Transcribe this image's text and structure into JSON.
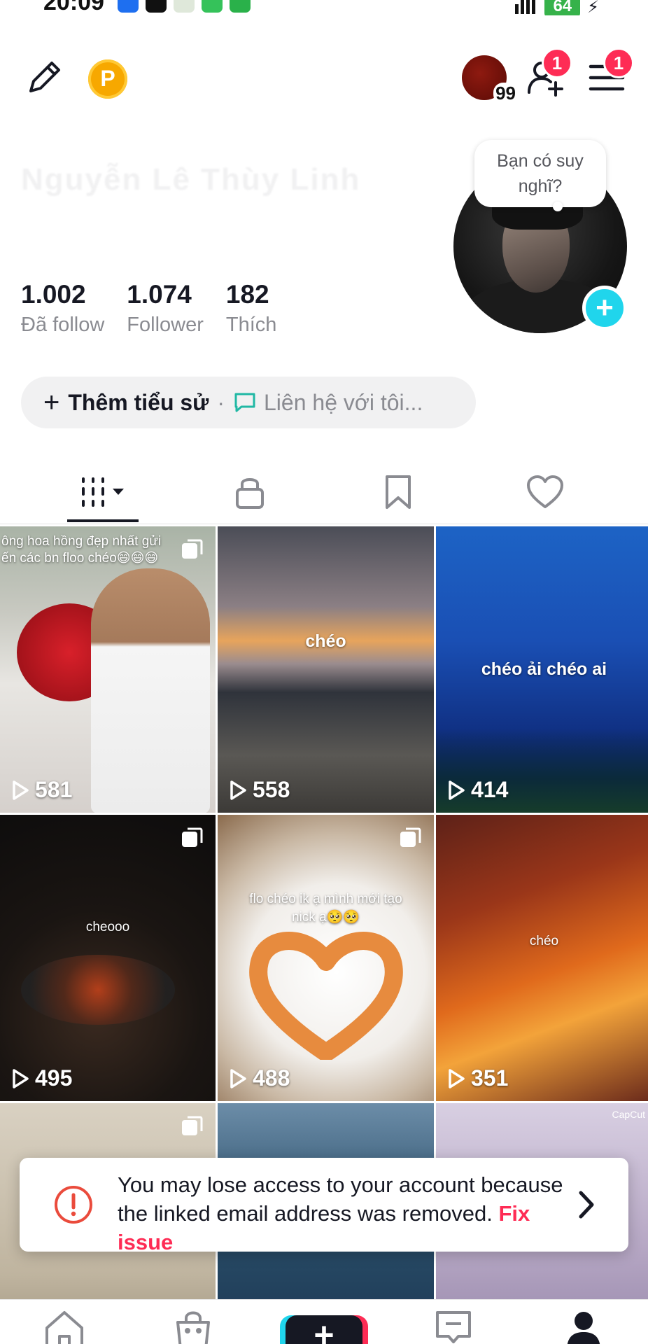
{
  "status_bar": {
    "time": "20:09",
    "battery": "64",
    "app_icons": [
      "zalo-icon",
      "tiktok-icon",
      "shield-app-icon",
      "message-app-icon",
      "grid-app-icon"
    ]
  },
  "topbar": {
    "mini_avatar_count": "99",
    "follow_requests_badge": "1",
    "menu_badge": "1",
    "coin_letter": "P"
  },
  "profile": {
    "name_blurred": "Nguyễn Lê Thùy Linh",
    "thought_bubble": "Bạn có suy nghĩ?",
    "stats": [
      {
        "value": "1.002",
        "label": "Đã follow"
      },
      {
        "value": "1.074",
        "label": "Follower"
      },
      {
        "value": "182",
        "label": "Thích"
      }
    ],
    "bio_add_label": "Thêm tiểu sử",
    "bio_separator": "·",
    "contact_label": "Liên hệ với tôi..."
  },
  "tabs": [
    "videos-grid-icon",
    "lock-icon",
    "bookmark-icon",
    "heart-icon"
  ],
  "videos": [
    {
      "caption": "ông hoa hồng đẹp nhất gửi\nến các bn floo chéo😄😄😄",
      "views": "581",
      "multi": true
    },
    {
      "caption": "chéo",
      "views": "558",
      "multi": false
    },
    {
      "caption": "chéo ải chéo ai",
      "views": "414",
      "multi": false
    },
    {
      "caption": "cheooo",
      "views": "495",
      "multi": true
    },
    {
      "caption": "flo chéo ik ạ mình mới tạo\nnick ạ🥺🥺",
      "views": "488",
      "multi": true
    },
    {
      "caption": "chéo",
      "views": "351",
      "multi": false
    },
    {
      "caption": "",
      "views": "",
      "multi": true
    },
    {
      "caption": "",
      "views": "",
      "multi": false
    },
    {
      "caption": "",
      "views": "",
      "multi": false,
      "watermark": "CapCut"
    }
  ],
  "toast": {
    "message": "You may lose access to your account because the linked email address was removed.",
    "link": "Fix issue"
  },
  "colors": {
    "accent_red": "#fe2c55",
    "accent_cyan": "#20d5ec",
    "text_primary": "#161823",
    "text_secondary": "#8a8b91"
  }
}
